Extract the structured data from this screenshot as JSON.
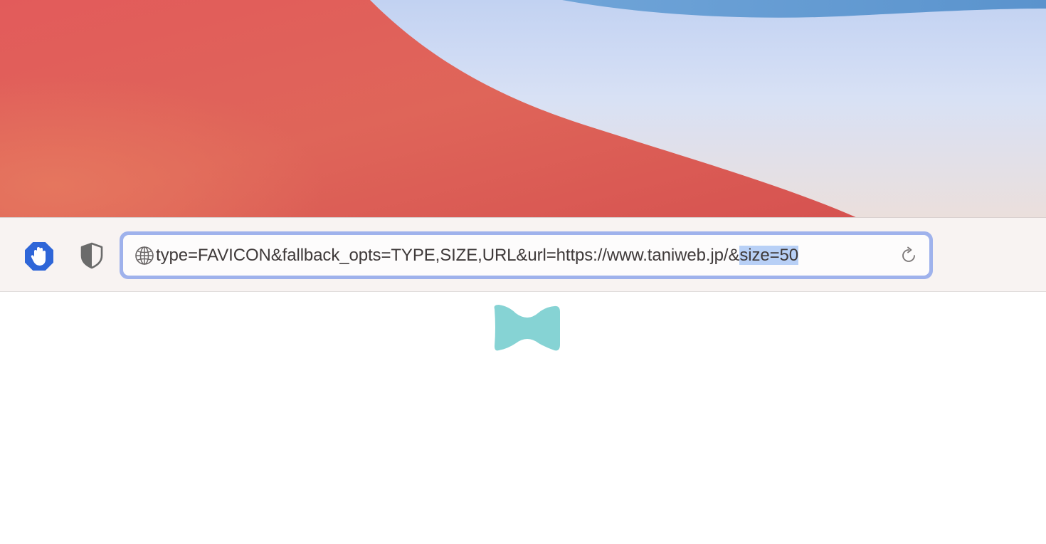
{
  "wallpaper": {
    "colors": {
      "sky_top": "#5f98d1",
      "sky_light": "#dbe4f6",
      "peach": "#e9dcd8",
      "red": "#e05a58",
      "red_dark": "#d65050",
      "orange_red": "#e5705e"
    }
  },
  "toolbar": {
    "adblock_icon": "hand-stop-icon",
    "privacy_icon": "shield-half-icon",
    "address_bar": {
      "site_icon": "globe-icon",
      "url_prefix": "type=FAVICON&fallback_opts=TYPE,SIZE,URL&url=https://www.taniweb.jp/&",
      "url_selected": "size=50",
      "reload_icon": "reload-icon",
      "focus_ring_color": "#9fb2ec",
      "selection_color": "#b8d0f6"
    }
  },
  "content": {
    "image_icon": "bowtie-favicon",
    "image_color": "#86d3d4"
  }
}
